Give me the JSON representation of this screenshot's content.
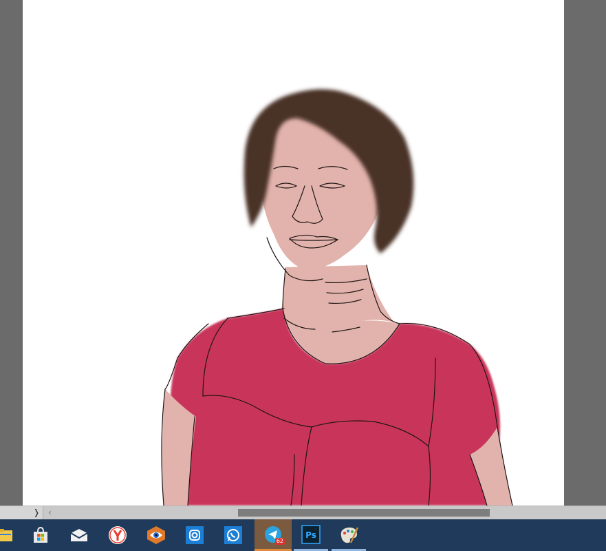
{
  "canvas": {
    "background": "#ffffff",
    "image_subject": "digital-illustration-portrait",
    "colors": {
      "hair": "#4a3028",
      "skin": "#e2b3ac",
      "shirt": "#c9355a",
      "outline": "#1e1414",
      "workspace": "#6b6b6b"
    }
  },
  "scrollbar": {
    "right_arrow": "❭",
    "left_arrow": "‹"
  },
  "taskbar": {
    "background": "#1f3a5a",
    "apps": [
      {
        "icon": "file-explorer-icon"
      },
      {
        "icon": "microsoft-store-icon"
      },
      {
        "icon": "mail-icon"
      },
      {
        "icon": "yandex-browser-icon"
      },
      {
        "icon": "image-viewer-eye-icon"
      },
      {
        "icon": "instagram-icon"
      },
      {
        "icon": "whatsapp-icon"
      },
      {
        "icon": "telegram-icon",
        "badge": "62",
        "active": true
      },
      {
        "icon": "photoshop-icon",
        "label": "Ps"
      },
      {
        "icon": "paint-palette-icon"
      }
    ]
  }
}
